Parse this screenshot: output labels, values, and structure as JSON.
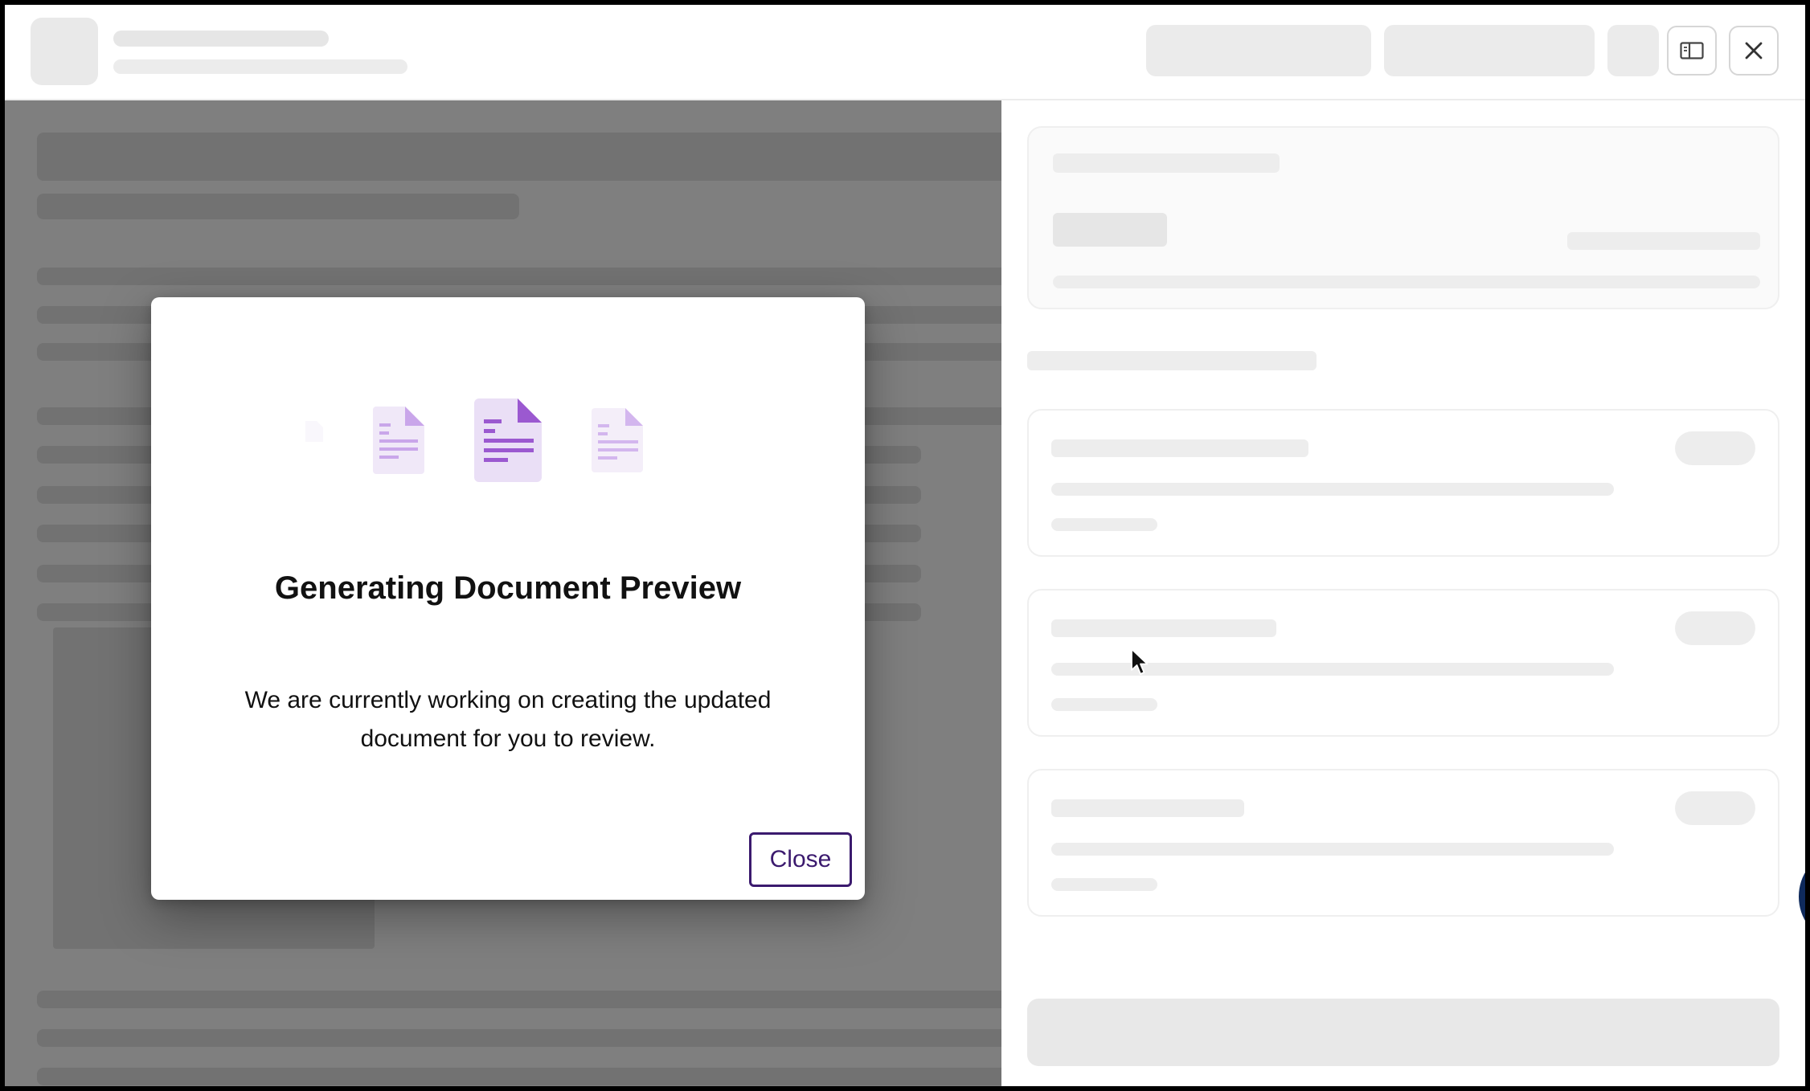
{
  "modal": {
    "title": "Generating Document Preview",
    "message": "We are currently working on creating the updated document for you to review.",
    "close_label": "Close"
  },
  "header": {
    "icons": [
      "panel-toggle-icon",
      "close-icon"
    ]
  },
  "colors": {
    "accent": "#9b59d0",
    "close_button": "#3b1a6e",
    "skeleton": "#e6e6e6"
  }
}
